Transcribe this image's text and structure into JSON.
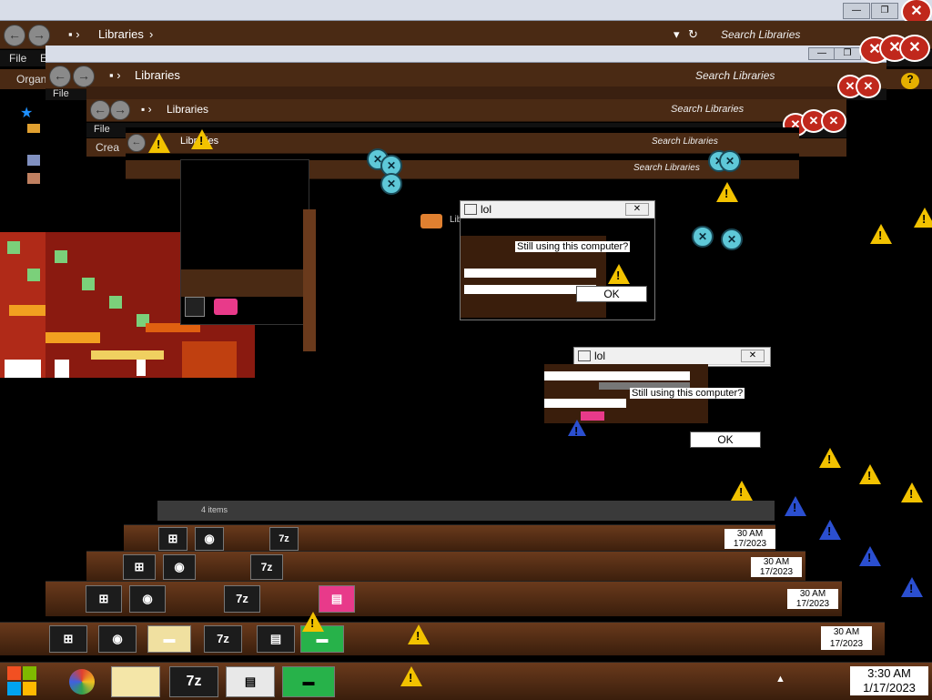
{
  "explorer": {
    "breadcrumb": "Libraries",
    "search_placeholder": "Search Libraries",
    "menu_file": "File",
    "menu_edit": "E",
    "organize": "Organ",
    "create": "Crea",
    "items_count": "4 items",
    "lib_label": "Libra"
  },
  "dialogs": [
    {
      "title": "lol",
      "message": "Still using this computer?",
      "ok_label": "OK"
    },
    {
      "title": "lol",
      "message": "Still using this computer?",
      "ok_label": "OK"
    }
  ],
  "taskbar": {
    "sevenzip_label": "7z",
    "time": "3:30 AM",
    "date": "1/17/2023",
    "time_partial": "30 AM",
    "date_partial": "17/2023"
  },
  "colors": {
    "brown": "#4a2a14",
    "warning": "#f2c200",
    "close_red": "#c0281c",
    "win_blue": "#1e90ff"
  }
}
